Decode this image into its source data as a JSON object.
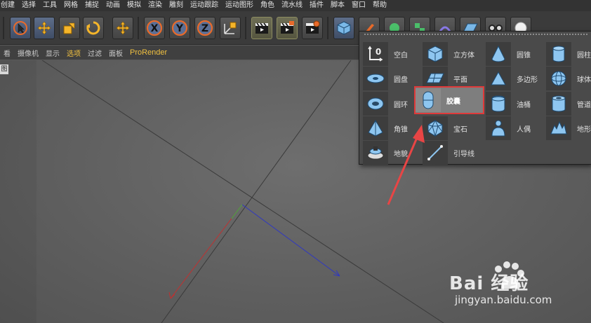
{
  "menu": {
    "items": [
      "创建",
      "选择",
      "工具",
      "网格",
      "捕捉",
      "动画",
      "模拟",
      "渲染",
      "雕刻",
      "运动跟踪",
      "运动图形",
      "角色",
      "流水线",
      "插件",
      "脚本",
      "窗口",
      "帮助"
    ]
  },
  "toolbar": {
    "icons": [
      "cursor-icon",
      "move-icon",
      "scale-icon",
      "rotate-icon",
      "move-icon",
      "x-axis-icon",
      "y-axis-icon",
      "z-axis-icon",
      "coordinate-icon",
      "render-clapper-icon",
      "render-view-icon",
      "render-settings-icon",
      "cube-icon",
      "pen-icon",
      "subdivision-icon",
      "cloner-icon",
      "deformer-icon",
      "floor-icon",
      "camera-icon",
      "light-icon"
    ]
  },
  "submenu": {
    "items": [
      "看",
      "摄像机",
      "显示",
      "选项",
      "过滤",
      "面板",
      "ProRender"
    ],
    "active": "选项"
  },
  "viewport": {
    "tag": "图"
  },
  "popup": {
    "items": [
      {
        "label": "空白",
        "icon": "null-icon"
      },
      {
        "label": "圆盘",
        "icon": "disc-icon"
      },
      {
        "label": "圆环",
        "icon": "torus-icon"
      },
      {
        "label": "角锥",
        "icon": "pyramid-icon"
      },
      {
        "label": "地貌",
        "icon": "landscape-icon"
      },
      {
        "label": "立方体",
        "icon": "cube-icon"
      },
      {
        "label": "平面",
        "icon": "plane-icon"
      },
      {
        "label": "胶囊",
        "icon": "capsule-icon"
      },
      {
        "label": "宝石",
        "icon": "gem-icon"
      },
      {
        "label": "引导线",
        "icon": "guide-icon"
      },
      {
        "label": "圆锥",
        "icon": "cone-icon"
      },
      {
        "label": "多边形",
        "icon": "polygon-icon"
      },
      {
        "label": "油桶",
        "icon": "oiltank-icon"
      },
      {
        "label": "人偶",
        "icon": "figure-icon"
      },
      {
        "label": "圆柱",
        "icon": "cylinder-icon"
      },
      {
        "label": "球体",
        "icon": "sphere-icon"
      },
      {
        "label": "管道",
        "icon": "tube-icon"
      },
      {
        "label": "地形",
        "icon": "terrain-icon"
      }
    ],
    "selected": "胶囊"
  },
  "watermark": {
    "brand": "Bai 经验",
    "url": "jingyan.baidu.com"
  },
  "colors": {
    "accent": "#f0c040",
    "highlight_border": "#e03a3a",
    "icon_blue": "#8ec6f0"
  }
}
